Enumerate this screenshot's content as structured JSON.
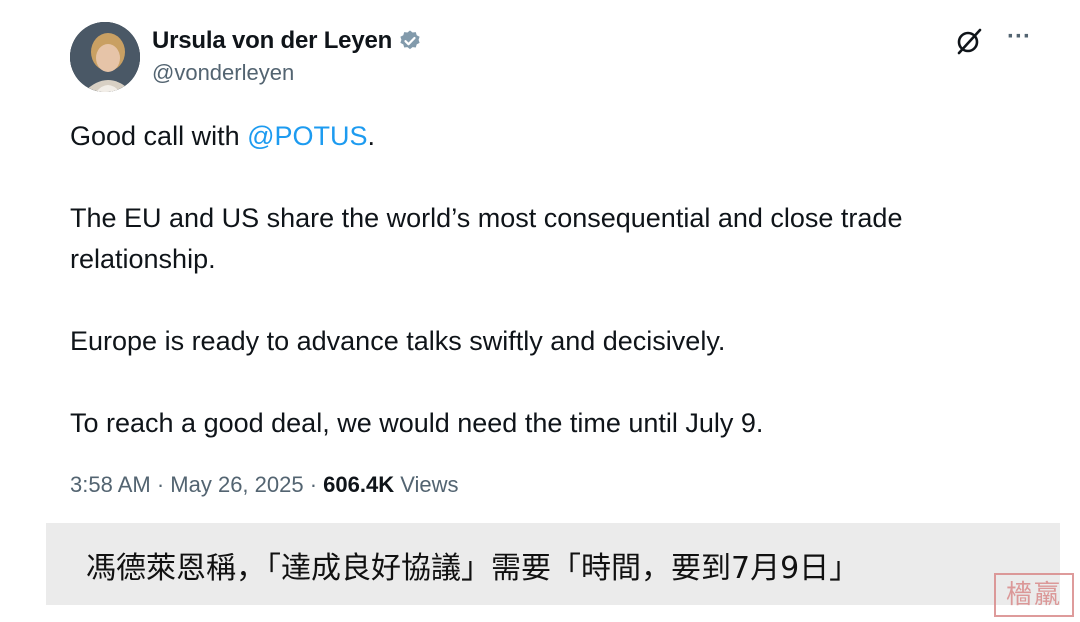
{
  "tweet": {
    "author": {
      "display_name": "Ursula von der Leyen",
      "handle": "@vonderleyen",
      "verified": true
    },
    "icons": {
      "verified": "verified-badge-icon",
      "grok": "grok-icon",
      "more": "more-options-icon"
    },
    "more_symbol": "···",
    "body": {
      "line1_prefix": "Good call with ",
      "line1_mention": "@POTUS",
      "line1_suffix": ".",
      "paragraph2": "The EU and US share the world’s most consequential and close trade relationship.",
      "paragraph3": "Europe is ready to advance talks swiftly and decisively.",
      "paragraph4": "To reach a good deal, we would need the time until July 9."
    },
    "meta": {
      "time": "3:58 AM",
      "separator": " · ",
      "date": "May 26, 2025",
      "views_count": "606.4K",
      "views_label": " Views"
    }
  },
  "caption": {
    "text": "馮德萊恩稱，「達成良好協議」需要「時間，要到7月9日」"
  },
  "watermark": {
    "text": "檣羸"
  },
  "colors": {
    "mention": "#1d9bf0",
    "secondary_text": "#536471",
    "caption_background": "#ebebeb",
    "watermark": "#d98a8a"
  }
}
